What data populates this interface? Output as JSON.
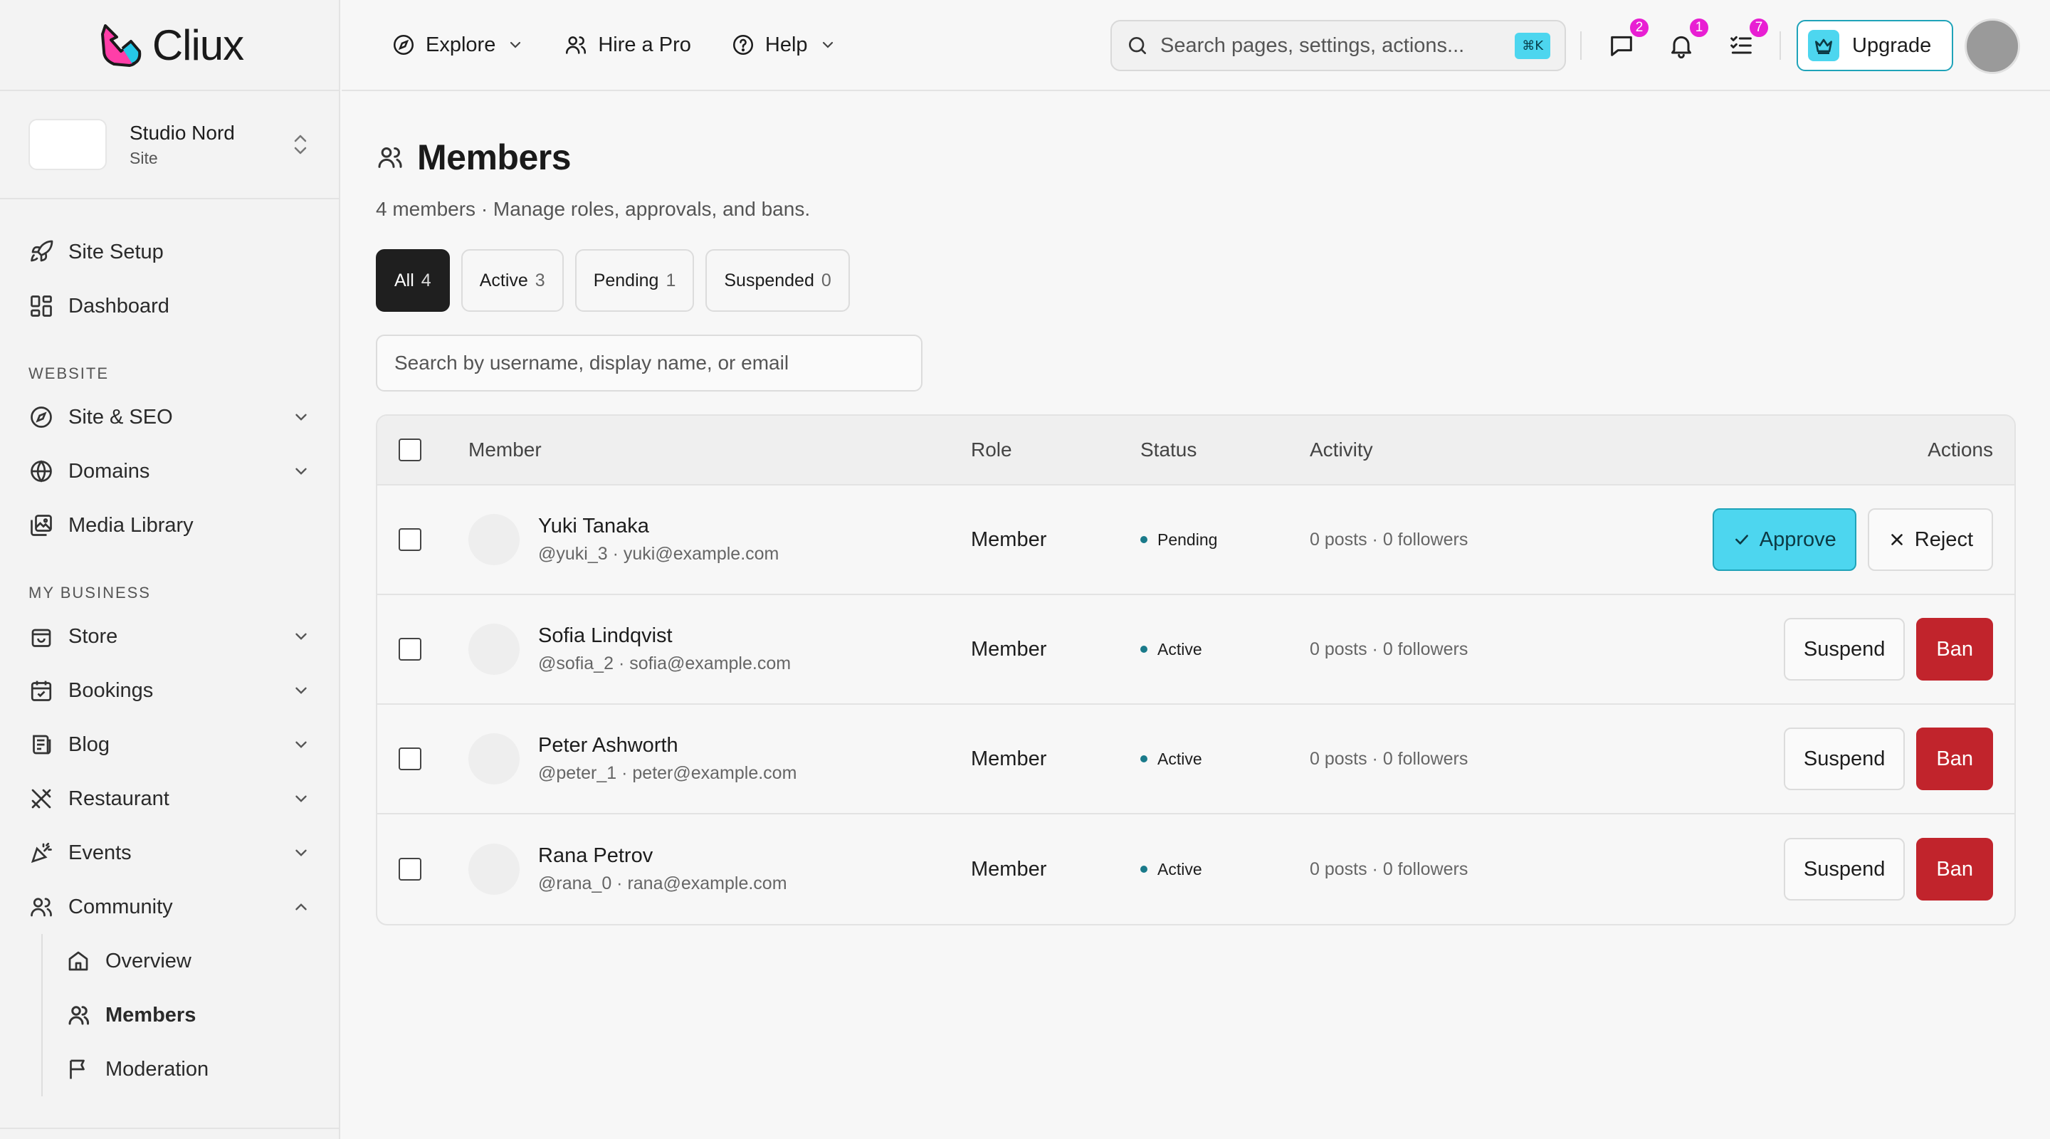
{
  "app": {
    "logo_text": "Cliux"
  },
  "site": {
    "name": "Studio Nord",
    "type": "Site"
  },
  "sidebar": {
    "top_items": [
      {
        "label": "Site Setup",
        "icon": "rocket-icon"
      },
      {
        "label": "Dashboard",
        "icon": "dashboard-icon"
      }
    ],
    "sections": [
      {
        "title": "WEBSITE",
        "items": [
          {
            "label": "Site & SEO",
            "icon": "compass-icon"
          },
          {
            "label": "Domains",
            "icon": "globe-icon"
          },
          {
            "label": "Media Library",
            "icon": "media-icon"
          }
        ]
      },
      {
        "title": "MY BUSINESS",
        "items": [
          {
            "label": "Store",
            "icon": "store-icon"
          },
          {
            "label": "Bookings",
            "icon": "calendar-icon"
          },
          {
            "label": "Blog",
            "icon": "blog-icon"
          },
          {
            "label": "Restaurant",
            "icon": "utensils-icon"
          },
          {
            "label": "Events",
            "icon": "party-icon"
          },
          {
            "label": "Community",
            "icon": "users-icon"
          }
        ]
      }
    ],
    "community_sub": [
      {
        "label": "Overview",
        "icon": "home-icon"
      },
      {
        "label": "Members",
        "icon": "user-icon"
      },
      {
        "label": "Moderation",
        "icon": "flag-icon"
      }
    ]
  },
  "topbar": {
    "explore": "Explore",
    "hire": "Hire a Pro",
    "help": "Help",
    "search_placeholder": "Search pages, settings, actions...",
    "shortcut": "⌘K",
    "badges": {
      "messages": "2",
      "notifications": "1",
      "tasks": "7"
    },
    "upgrade": "Upgrade"
  },
  "page": {
    "title": "Members",
    "subtitle": "4 members · Manage roles, approvals, and bans.",
    "tabs": [
      {
        "label": "All",
        "count": "4"
      },
      {
        "label": "Active",
        "count": "3"
      },
      {
        "label": "Pending",
        "count": "1"
      },
      {
        "label": "Suspended",
        "count": "0"
      }
    ],
    "search_placeholder": "Search by username, display name, or email"
  },
  "table": {
    "headers": {
      "member": "Member",
      "role": "Role",
      "status": "Status",
      "activity": "Activity",
      "actions": "Actions"
    },
    "rows": [
      {
        "name": "Yuki Tanaka",
        "meta": "@yuki_3 · yuki@example.com",
        "role": "Member",
        "status": "Pending",
        "activity": "0 posts · 0 followers",
        "actions": [
          "Approve",
          "Reject"
        ]
      },
      {
        "name": "Sofia Lindqvist",
        "meta": "@sofia_2 · sofia@example.com",
        "role": "Member",
        "status": "Active",
        "activity": "0 posts · 0 followers",
        "actions": [
          "Suspend",
          "Ban"
        ]
      },
      {
        "name": "Peter Ashworth",
        "meta": "@peter_1 · peter@example.com",
        "role": "Member",
        "status": "Active",
        "activity": "0 posts · 0 followers",
        "actions": [
          "Suspend",
          "Ban"
        ]
      },
      {
        "name": "Rana Petrov",
        "meta": "@rana_0 · rana@example.com",
        "role": "Member",
        "status": "Active",
        "activity": "0 posts · 0 followers",
        "actions": [
          "Suspend",
          "Ban"
        ]
      }
    ]
  },
  "colors": {
    "accent": "#4dd6ef",
    "ban": "#c1242c",
    "badge": "#e81fd3"
  }
}
